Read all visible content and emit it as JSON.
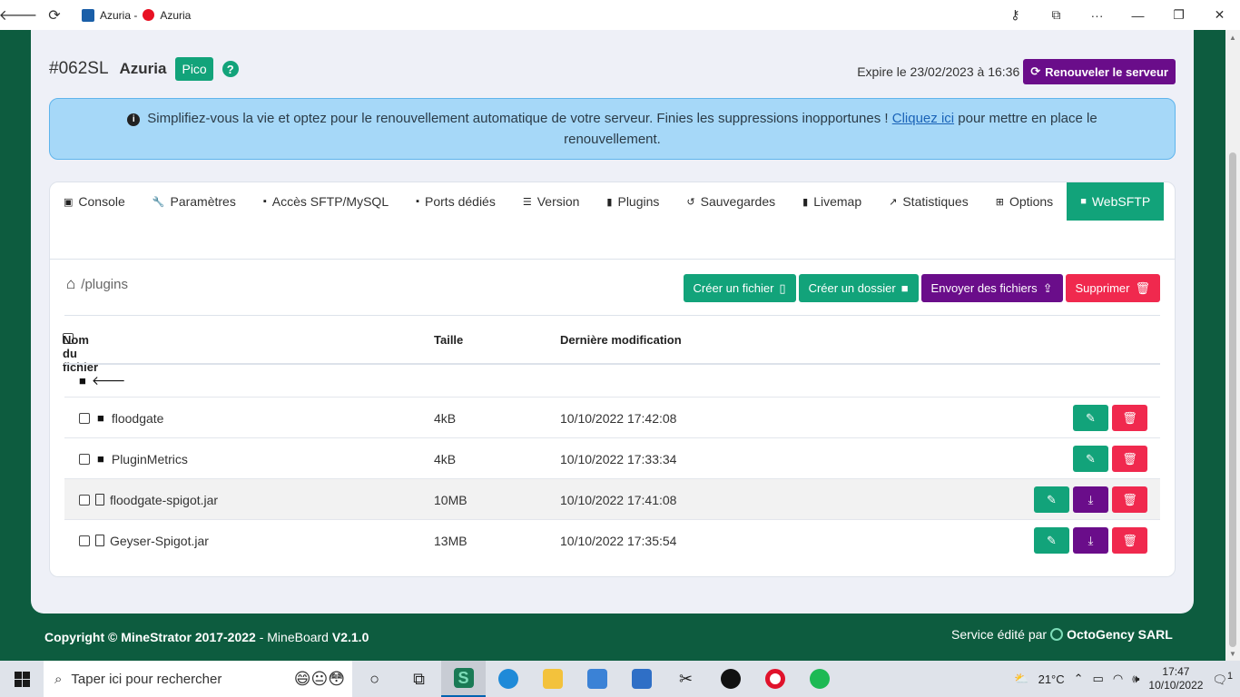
{
  "browser": {
    "tab_title": "Azuria - ",
    "recording_label": "Azuria"
  },
  "server": {
    "id": "#062SL",
    "name": "Azuria",
    "plan_badge": "Pico",
    "help_label": "?",
    "expire_text": "Expire le 23/02/2023 à 16:36",
    "renew_button": "Renouveler le serveur"
  },
  "alert": {
    "text_before": "Simplifiez-vous la vie et optez pour le renouvellement automatique de votre serveur. Finies les suppressions inopportunes !",
    "link_text": "Cliquez ici",
    "text_after": "pour mettre en place le renouvellement."
  },
  "tabs": [
    {
      "label": "Console",
      "icon": "terminal-icon",
      "glyph": "▣"
    },
    {
      "label": "Paramètres",
      "icon": "wrench-icon",
      "glyph": "🔧"
    },
    {
      "label": "Accès SFTP/MySQL",
      "icon": "folder-key-icon",
      "glyph": "▪"
    },
    {
      "label": "Ports dédiés",
      "icon": "folder-port-icon",
      "glyph": "▪"
    },
    {
      "label": "Version",
      "icon": "list-icon",
      "glyph": "☰"
    },
    {
      "label": "Plugins",
      "icon": "file-icon",
      "glyph": "▮"
    },
    {
      "label": "Sauvegardes",
      "icon": "history-icon",
      "glyph": "↺"
    },
    {
      "label": "Livemap",
      "icon": "map-icon",
      "glyph": "▮"
    },
    {
      "label": "Statistiques",
      "icon": "chart-icon",
      "glyph": "↗"
    },
    {
      "label": "Options",
      "icon": "plus-square-icon",
      "glyph": "⊞"
    },
    {
      "label": "WebSFTP",
      "icon": "folder-icon",
      "glyph": "■"
    }
  ],
  "sftp": {
    "path": "/plugins",
    "actions": {
      "create_file": "Créer un fichier",
      "create_folder": "Créer un dossier",
      "upload": "Envoyer des fichiers",
      "delete": "Supprimer"
    },
    "columns": {
      "name": "Nom du fichier",
      "size": "Taille",
      "modified": "Dernière modification"
    },
    "rows": [
      {
        "name": "floodgate",
        "type": "folder",
        "size": "4kB",
        "modified": "10/10/2022 17:42:08"
      },
      {
        "name": "PluginMetrics",
        "type": "folder",
        "size": "4kB",
        "modified": "10/10/2022 17:33:34"
      },
      {
        "name": "floodgate-spigot.jar",
        "type": "file",
        "size": "10MB",
        "modified": "10/10/2022 17:41:08"
      },
      {
        "name": "Geyser-Spigot.jar",
        "type": "file",
        "size": "13MB",
        "modified": "10/10/2022 17:35:54"
      }
    ]
  },
  "footer": {
    "copyright_prefix": "Copyright © MineStrator 2017-2022",
    "copyright_mid": " - MineBoard ",
    "version": "V2.1.0",
    "service_prefix": "Service édité par ",
    "company": "OctoGency SARL"
  },
  "taskbar": {
    "search_placeholder": "Taper ici pour rechercher",
    "weather": "21°C",
    "time": "17:47",
    "date": "10/10/2022",
    "notification_count": "1"
  },
  "colors": {
    "brand_green": "#12a37a",
    "purple": "#6a0d8a",
    "danger": "#f0294e",
    "page_bg": "#0d5c3f"
  }
}
